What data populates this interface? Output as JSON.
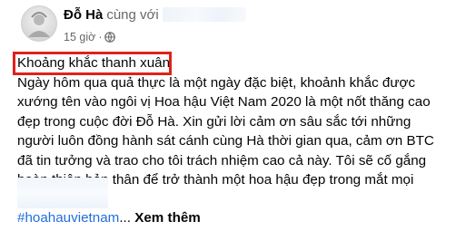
{
  "post": {
    "author": "Đỗ Hà",
    "with_text": "cùng với",
    "time": "15 giờ",
    "separator": "·",
    "privacy_icon": "globe-icon",
    "heading": "Khoảng khắc thanh xuân",
    "body": "Ngày hôm qua quả thực là một ngày đặc biệt, khoảnh khắc được xướng tên vào ngôi vị Hoa hậu Việt Nam 2020 là một nốt thăng cao đẹp trong cuộc đời Đỗ Hà. Xin gửi lời cảm ơn sâu sắc tới những người luôn đồng hành sát cánh cùng Hà thời gian qua, cảm ơn BTC đã tin tưởng và trao cho tôi trách nhiệm cao cả này. Tôi sẽ cố gắng hoàn thiện bản thân để trở thành một hoa hậu đẹp trong mắt mọi người",
    "hashtag": "#hoahauvietnam",
    "ellipsis": "...",
    "see_more": "Xem thêm"
  },
  "colors": {
    "highlight": "#e0211b",
    "link": "#216fdb",
    "meta": "#65676b"
  }
}
